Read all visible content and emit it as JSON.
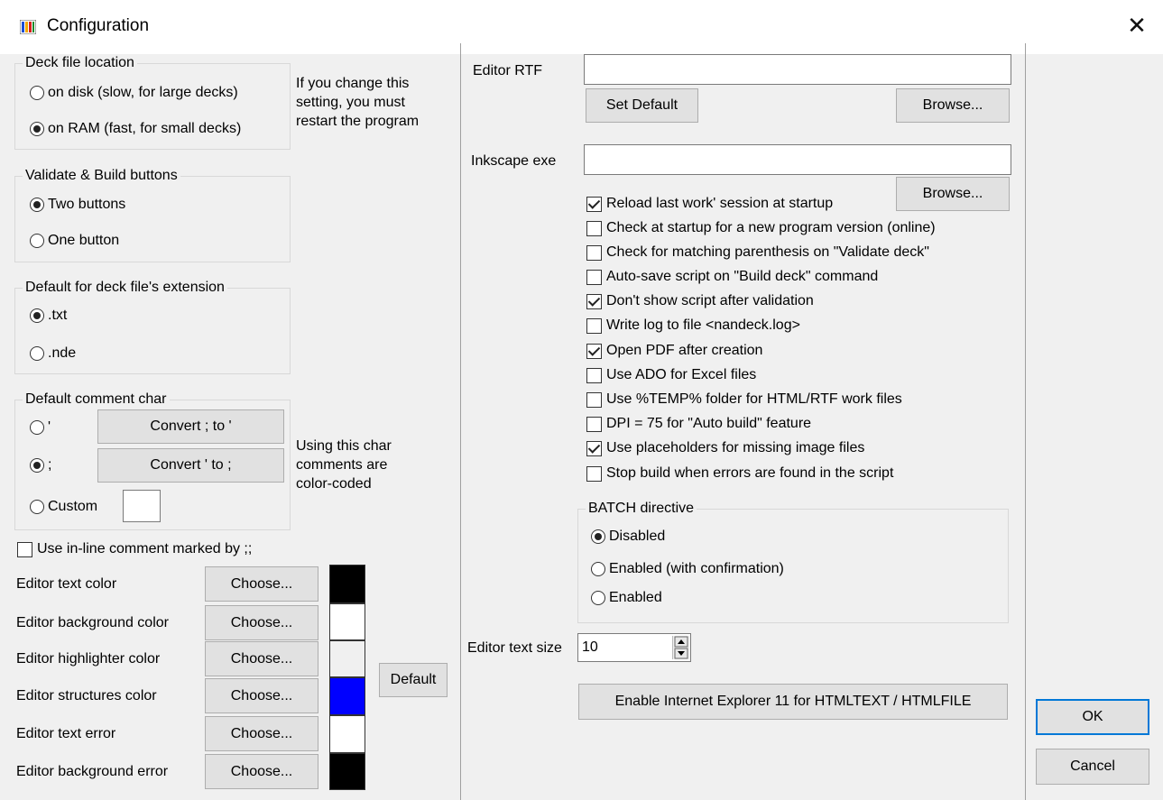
{
  "window": {
    "title": "Configuration",
    "close_symbol": "✕"
  },
  "deck_file_location": {
    "legend": "Deck file location",
    "options": [
      {
        "label": "on disk (slow, for large decks)",
        "checked": false
      },
      {
        "label": "on RAM (fast, for small decks)",
        "checked": true
      }
    ],
    "note": [
      "If you change this",
      "setting, you must",
      "restart the program"
    ]
  },
  "validate_build": {
    "legend": "Validate & Build buttons",
    "options": [
      {
        "label": "Two buttons",
        "checked": true
      },
      {
        "label": "One button",
        "checked": false
      }
    ]
  },
  "deck_extension": {
    "legend": "Default for deck file's extension",
    "options": [
      {
        "label": ".txt",
        "checked": true
      },
      {
        "label": ".nde",
        "checked": false
      }
    ]
  },
  "comment_char": {
    "legend": "Default comment char",
    "options": [
      {
        "label": "'",
        "checked": false
      },
      {
        "label": ";",
        "checked": true
      },
      {
        "label": "Custom",
        "checked": false
      }
    ],
    "convert_to_apostrophe": "Convert ; to '",
    "convert_to_semicolon": "Convert ' to ;",
    "custom_value": "",
    "note": [
      "Using this char",
      "comments are",
      "color-coded"
    ]
  },
  "inline_comment": {
    "label": "Use in-line comment marked by ;;",
    "checked": false
  },
  "colors": {
    "choose_label": "Choose...",
    "default_label": "Default",
    "rows": [
      {
        "label": "Editor text color",
        "color": "#000000"
      },
      {
        "label": "Editor background color",
        "color": "#ffffff"
      },
      {
        "label": "Editor highlighter color",
        "color": "#f0f0f0"
      },
      {
        "label": "Editor structures color",
        "color": "#0000ff"
      },
      {
        "label": "Editor text error",
        "color": "#ffffff"
      },
      {
        "label": "Editor background error",
        "color": "#000000"
      }
    ]
  },
  "editor_rtf": {
    "label": "Editor RTF",
    "value": "",
    "set_default": "Set Default",
    "browse": "Browse..."
  },
  "inkscape": {
    "label": "Inkscape exe",
    "value": "",
    "browse": "Browse..."
  },
  "options": [
    {
      "label": "Reload last work' session at startup",
      "checked": true
    },
    {
      "label": "Check at startup for a new program version (online)",
      "checked": false
    },
    {
      "label": "Check for matching parenthesis on \"Validate deck\"",
      "checked": false
    },
    {
      "label": "Auto-save script on \"Build deck\" command",
      "checked": false
    },
    {
      "label": "Don't show script after validation",
      "checked": true
    },
    {
      "label": "Write log to file <nandeck.log>",
      "checked": false
    },
    {
      "label": "Open PDF after creation",
      "checked": true
    },
    {
      "label": "Use ADO for Excel files",
      "checked": false
    },
    {
      "label": "Use %TEMP% folder for HTML/RTF work files",
      "checked": false
    },
    {
      "label": "DPI = 75 for \"Auto build\" feature",
      "checked": false
    },
    {
      "label": "Use placeholders for missing image files",
      "checked": true
    },
    {
      "label": "Stop build when errors are found in the script",
      "checked": false
    }
  ],
  "batch": {
    "legend": "BATCH directive",
    "options": [
      {
        "label": "Disabled",
        "checked": true
      },
      {
        "label": "Enabled (with confirmation)",
        "checked": false
      },
      {
        "label": "Enabled",
        "checked": false
      }
    ]
  },
  "text_size": {
    "label": "Editor text size",
    "value": "10"
  },
  "ie_button": "Enable Internet Explorer 11 for HTMLTEXT / HTMLFILE",
  "buttons": {
    "ok": "OK",
    "cancel": "Cancel"
  },
  "accent_color": "#0078d7"
}
